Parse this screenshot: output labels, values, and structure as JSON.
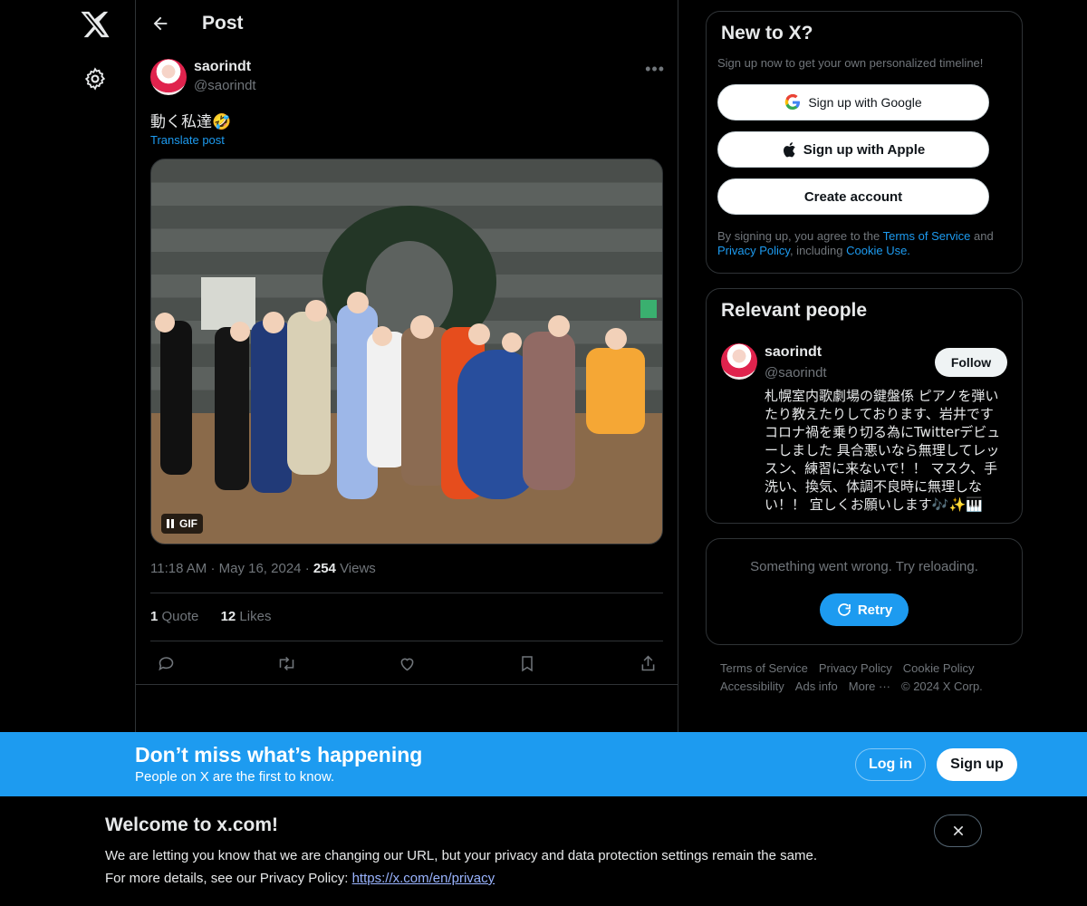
{
  "nav": {
    "logo_icon": "x-logo-icon",
    "settings_icon": "gear-icon"
  },
  "header": {
    "back_icon": "arrow-left-icon",
    "title": "Post"
  },
  "post": {
    "author_name": "saorindt",
    "author_handle": "@saorindt",
    "more_icon": "more-horizontal-icon",
    "text": "動く私達🤣",
    "translate": "Translate post",
    "media_badge": "GIF",
    "time": "11:18 AM",
    "date": "May 16, 2024",
    "views_count": "254",
    "views_label": "Views",
    "quotes_count": "1",
    "quotes_label": "Quote",
    "likes_count": "12",
    "likes_label": "Likes",
    "actions": [
      "reply-icon",
      "repost-icon",
      "like-icon",
      "bookmark-icon",
      "share-icon"
    ]
  },
  "signup_card": {
    "title": "New to X?",
    "subtitle": "Sign up now to get your own personalized timeline!",
    "google": "Sign up with Google",
    "apple": "Sign up with Apple",
    "create": "Create account",
    "legal_1": "By signing up, you agree to the ",
    "terms": "Terms of Service",
    "legal_2": " and ",
    "privacy": "Privacy Policy",
    "legal_3": ", including ",
    "cookie": "Cookie Use."
  },
  "relevant": {
    "title": "Relevant people",
    "name": "saorindt",
    "handle": "@saorindt",
    "follow": "Follow",
    "bio": "札幌室内歌劇場の鍵盤係 ピアノを弾いたり教えたりしております、岩井です コロナ禍を乗り切る為にTwitterデビューしました 具合悪いなら無理してレッスン、練習に来ないで！！ マスク、手洗い、換気、体調不良時に無理しない！！ 宜しくお願いします🎶✨🎹"
  },
  "error_card": {
    "message": "Something went wrong. Try reloading.",
    "retry": "Retry"
  },
  "footer": {
    "line1": [
      "Terms of Service",
      "Privacy Policy",
      "Cookie Policy"
    ],
    "line2": [
      "Accessibility",
      "Ads info",
      "More ···",
      "© 2024 X Corp."
    ]
  },
  "banner": {
    "title": "Don’t miss what’s happening",
    "subtitle": "People on X are the first to know.",
    "login": "Log in",
    "signup": "Sign up"
  },
  "notice": {
    "title": "Welcome to x.com!",
    "line1": "We are letting you know that we are changing our URL, but your privacy and data protection settings remain the same.",
    "line2": "For more details, see our Privacy Policy: ",
    "link": "https://x.com/en/privacy"
  }
}
